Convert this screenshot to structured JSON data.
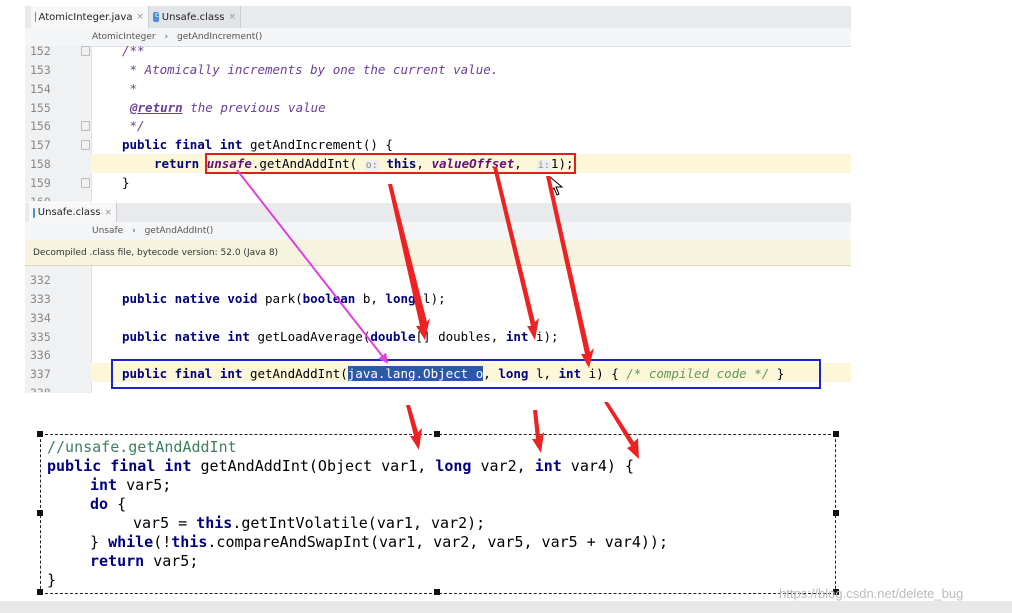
{
  "editor_top": {
    "tabs": [
      {
        "label": "AtomicInteger.java",
        "close": "×"
      },
      {
        "label": "Unsafe.class",
        "close": "×"
      }
    ],
    "breadcrumb": [
      "AtomicInteger",
      "getAndIncrement()"
    ],
    "breadcrumb_sep": "›",
    "line_numbers": [
      "152",
      "153",
      "154",
      "155",
      "156",
      "157",
      "158",
      "159",
      "160"
    ],
    "lines": {
      "l152": "/**",
      "l153": " * Atomically increments by one the current value.",
      "l154": " *",
      "l155_tag": "@return",
      "l155_text": " the previous value",
      "l156": " */",
      "l157_kw": "public final int",
      "l157_text": " getAndIncrement() {",
      "l158_kw": "return",
      "l158_unsafe": "unsafe",
      "l158_call": ".getAndAddInt(",
      "l158_hint_o": "o:",
      "l158_this": "this",
      "l158_comma1": ",",
      "l158_field": "valueOffset",
      "l158_comma2": ",",
      "l158_hint_i": "i:",
      "l158_end": "1);",
      "l159": "}"
    }
  },
  "editor_bottom": {
    "tab": {
      "label": "Unsafe.class",
      "close": "×"
    },
    "breadcrumb": [
      "Unsafe",
      "getAndAddInt()"
    ],
    "breadcrumb_sep": "›",
    "notice": "Decompiled .class file, bytecode version: 52.0 (Java 8)",
    "line_numbers": [
      "332",
      "333",
      "334",
      "335",
      "336",
      "337",
      "338"
    ],
    "lines": {
      "l333_kw": "public native void",
      "l333_text": " park(",
      "l333_kw2": "boolean",
      "l333_text2": " b, ",
      "l333_kw3": "long",
      "l333_text3": " l);",
      "l335_kw": "public native int",
      "l335_text": " getLoadAverage(",
      "l335_kw2": "double",
      "l335_text2": "[] doubles, ",
      "l335_kw3": "int",
      "l335_text3": " i);",
      "l337_kw": "public final int",
      "l337_text": " getAndAddInt(",
      "l337_sel": "java.lang.Object o",
      "l337_text2": ", ",
      "l337_kw2": "long",
      "l337_text3": " l, ",
      "l337_kw3": "int",
      "l337_text4": " i) { ",
      "l337_comment": "/* compiled code */",
      "l337_end": " }"
    }
  },
  "snippet": {
    "comment": "//unsafe.getAndAddInt",
    "line1_kw": "public final int",
    "line1_a": " getAndAddInt(Object var1, ",
    "line1_kw2": "long",
    "line1_b": " var2, ",
    "line1_kw3": "int",
    "line1_c": " var4) {",
    "line2_kw": "int",
    "line2_text": " var5;",
    "line3_kw": "do",
    "line3_text": " {",
    "line4_a": "var5 = ",
    "line4_kw": "this",
    "line4_b": ".getIntVolatile(var1, var2);",
    "line5_a": "} ",
    "line5_kw": "while",
    "line5_b": "(!",
    "line5_kw2": "this",
    "line5_c": ".compareAndSwapInt(var1, var2, var5, var5 + var4));",
    "line6_kw": "return",
    "line6_text": " var5;",
    "line7": "}"
  },
  "watermark": "https://blog.csdn.net/delete_bug",
  "colors": {
    "red_box": "#e02020",
    "blue_box": "#1a24c8",
    "magenta_arrow": "#e040e0",
    "red_arrow": "#ee2222"
  }
}
